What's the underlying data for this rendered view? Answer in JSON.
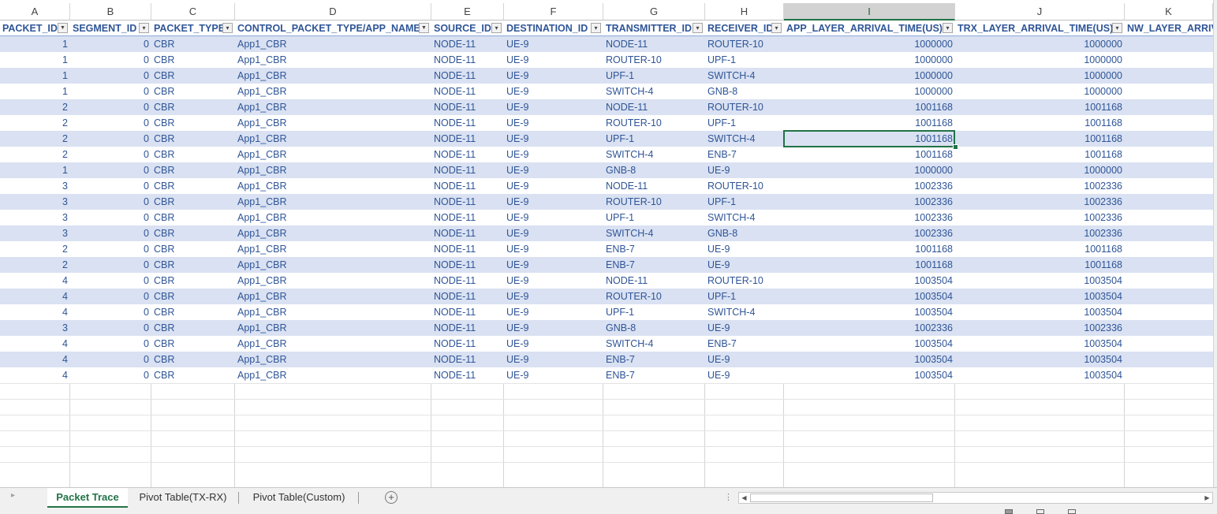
{
  "column_letters": [
    "A",
    "B",
    "C",
    "D",
    "E",
    "F",
    "G",
    "H",
    "I",
    "J",
    "K"
  ],
  "selected_column": "I",
  "headers": [
    "PACKET_ID",
    "SEGMENT_ID",
    "PACKET_TYPE",
    "CONTROL_PACKET_TYPE/APP_NAME",
    "SOURCE_ID",
    "DESTINATION_ID",
    "TRANSMITTER_ID",
    "RECEIVER_ID",
    "APP_LAYER_ARRIVAL_TIME(US)",
    "TRX_LAYER_ARRIVAL_TIME(US)",
    "NW_LAYER_ARRIV"
  ],
  "filter_icons": [
    "filter-applied-icon",
    "dropdown-arrow-icon",
    "dropdown-arrow-icon",
    "filter-applied-icon",
    "dropdown-arrow-icon",
    "dropdown-arrow-icon",
    "dropdown-arrow-icon",
    "dropdown-arrow-icon",
    "dropdown-arrow-icon",
    "dropdown-arrow-icon"
  ],
  "rows": [
    [
      "1",
      "0",
      "CBR",
      "App1_CBR",
      "NODE-11",
      "UE-9",
      "NODE-11",
      "ROUTER-10",
      "1000000",
      "1000000"
    ],
    [
      "1",
      "0",
      "CBR",
      "App1_CBR",
      "NODE-11",
      "UE-9",
      "ROUTER-10",
      "UPF-1",
      "1000000",
      "1000000"
    ],
    [
      "1",
      "0",
      "CBR",
      "App1_CBR",
      "NODE-11",
      "UE-9",
      "UPF-1",
      "SWITCH-4",
      "1000000",
      "1000000"
    ],
    [
      "1",
      "0",
      "CBR",
      "App1_CBR",
      "NODE-11",
      "UE-9",
      "SWITCH-4",
      "GNB-8",
      "1000000",
      "1000000"
    ],
    [
      "2",
      "0",
      "CBR",
      "App1_CBR",
      "NODE-11",
      "UE-9",
      "NODE-11",
      "ROUTER-10",
      "1001168",
      "1001168"
    ],
    [
      "2",
      "0",
      "CBR",
      "App1_CBR",
      "NODE-11",
      "UE-9",
      "ROUTER-10",
      "UPF-1",
      "1001168",
      "1001168"
    ],
    [
      "2",
      "0",
      "CBR",
      "App1_CBR",
      "NODE-11",
      "UE-9",
      "UPF-1",
      "SWITCH-4",
      "1001168",
      "1001168"
    ],
    [
      "2",
      "0",
      "CBR",
      "App1_CBR",
      "NODE-11",
      "UE-9",
      "SWITCH-4",
      "ENB-7",
      "1001168",
      "1001168"
    ],
    [
      "1",
      "0",
      "CBR",
      "App1_CBR",
      "NODE-11",
      "UE-9",
      "GNB-8",
      "UE-9",
      "1000000",
      "1000000"
    ],
    [
      "3",
      "0",
      "CBR",
      "App1_CBR",
      "NODE-11",
      "UE-9",
      "NODE-11",
      "ROUTER-10",
      "1002336",
      "1002336"
    ],
    [
      "3",
      "0",
      "CBR",
      "App1_CBR",
      "NODE-11",
      "UE-9",
      "ROUTER-10",
      "UPF-1",
      "1002336",
      "1002336"
    ],
    [
      "3",
      "0",
      "CBR",
      "App1_CBR",
      "NODE-11",
      "UE-9",
      "UPF-1",
      "SWITCH-4",
      "1002336",
      "1002336"
    ],
    [
      "3",
      "0",
      "CBR",
      "App1_CBR",
      "NODE-11",
      "UE-9",
      "SWITCH-4",
      "GNB-8",
      "1002336",
      "1002336"
    ],
    [
      "2",
      "0",
      "CBR",
      "App1_CBR",
      "NODE-11",
      "UE-9",
      "ENB-7",
      "UE-9",
      "1001168",
      "1001168"
    ],
    [
      "2",
      "0",
      "CBR",
      "App1_CBR",
      "NODE-11",
      "UE-9",
      "ENB-7",
      "UE-9",
      "1001168",
      "1001168"
    ],
    [
      "4",
      "0",
      "CBR",
      "App1_CBR",
      "NODE-11",
      "UE-9",
      "NODE-11",
      "ROUTER-10",
      "1003504",
      "1003504"
    ],
    [
      "4",
      "0",
      "CBR",
      "App1_CBR",
      "NODE-11",
      "UE-9",
      "ROUTER-10",
      "UPF-1",
      "1003504",
      "1003504"
    ],
    [
      "4",
      "0",
      "CBR",
      "App1_CBR",
      "NODE-11",
      "UE-9",
      "UPF-1",
      "SWITCH-4",
      "1003504",
      "1003504"
    ],
    [
      "3",
      "0",
      "CBR",
      "App1_CBR",
      "NODE-11",
      "UE-9",
      "GNB-8",
      "UE-9",
      "1002336",
      "1002336"
    ],
    [
      "4",
      "0",
      "CBR",
      "App1_CBR",
      "NODE-11",
      "UE-9",
      "SWITCH-4",
      "ENB-7",
      "1003504",
      "1003504"
    ],
    [
      "4",
      "0",
      "CBR",
      "App1_CBR",
      "NODE-11",
      "UE-9",
      "ENB-7",
      "UE-9",
      "1003504",
      "1003504"
    ],
    [
      "4",
      "0",
      "CBR",
      "App1_CBR",
      "NODE-11",
      "UE-9",
      "ENB-7",
      "UE-9",
      "1003504",
      "1003504"
    ]
  ],
  "numeric_columns": [
    0,
    1,
    8,
    9
  ],
  "selected_cell": {
    "column": "I",
    "row_index": 6
  },
  "sheet_tabs": [
    {
      "label": "Packet Trace",
      "active": true
    },
    {
      "label": "Pivot Table(TX-RX)",
      "active": false
    },
    {
      "label": "Pivot Table(Custom)",
      "active": false
    }
  ],
  "icons": {
    "add_sheet": "plus-circle-icon",
    "tab_nav": "chevron-right-icon",
    "scroll_left": "triangle-left-icon",
    "scroll_right": "triangle-right-icon"
  },
  "colors": {
    "band": "#d9e1f2",
    "text": "#2f5597",
    "accent": "#217346"
  }
}
